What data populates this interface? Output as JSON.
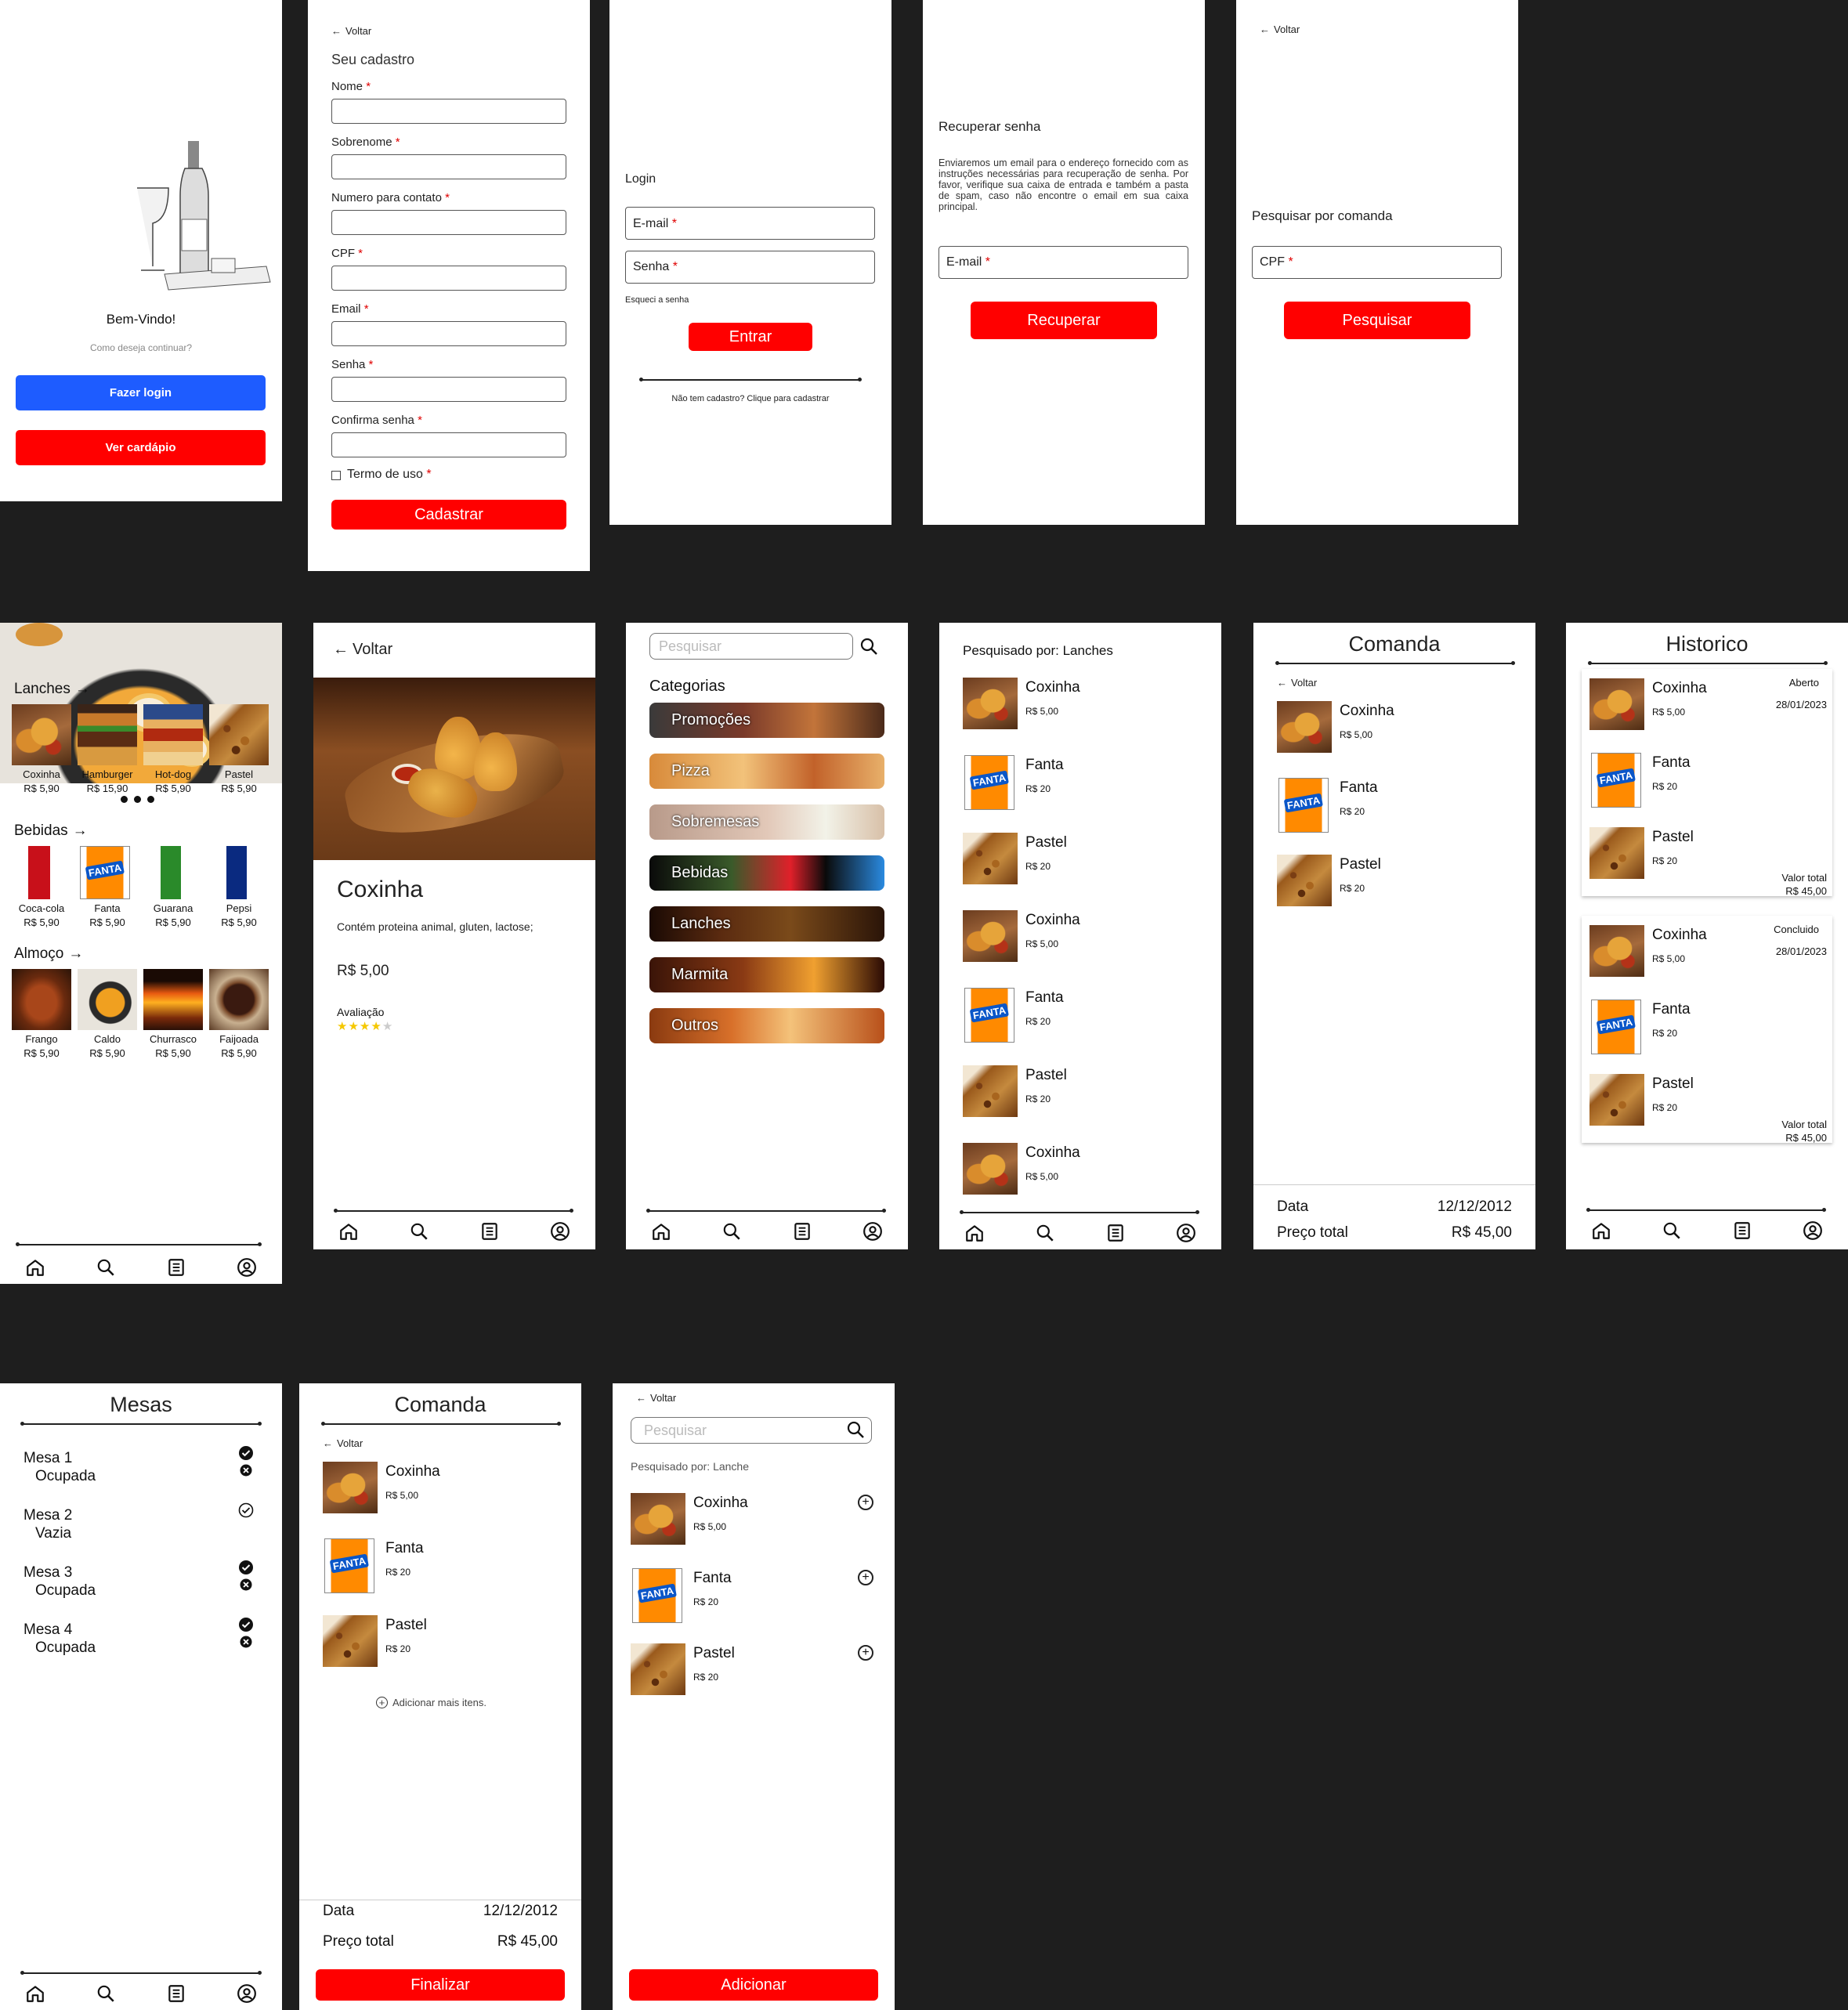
{
  "common": {
    "voltar": "Voltar",
    "required_mark": "*"
  },
  "welcome": {
    "title": "Bem-Vindo!",
    "subtitle": "Como deseja continuar?",
    "login_button": "Fazer login",
    "menu_button": "Ver cardápio"
  },
  "signup": {
    "title": "Seu cadastro",
    "fields": [
      "Nome",
      "Sobrenome",
      "Numero para contato",
      "CPF",
      "Email",
      "Senha",
      "Confirma senha"
    ],
    "terms": "Termo de uso",
    "submit": "Cadastrar"
  },
  "login": {
    "title": "Login",
    "email_label": "E-mail",
    "password_label": "Senha",
    "forgot": "Esqueci a senha",
    "submit": "Entrar",
    "register_link": "Não tem cadastro? Clique para cadastrar"
  },
  "recover": {
    "title": "Recuperar senha",
    "text": "Enviaremos um email para o endereço fornecido com as instruções necessárias para recuperação de senha. Por favor, verifique sua caixa de entrada e também a pasta de spam, caso não encontre o email em sua caixa principal.",
    "email_label": "E-mail",
    "submit": "Recuperar"
  },
  "search_comanda": {
    "title": "Pesquisar por comanda",
    "cpf_label": "CPF",
    "submit": "Pesquisar"
  },
  "menu": {
    "sections": [
      {
        "title": "Lanches",
        "items": [
          {
            "name": "Coxinha",
            "price": "R$ 5,90",
            "img": "coxinha"
          },
          {
            "name": "Hamburger",
            "price": "R$ 15,90",
            "img": "burger"
          },
          {
            "name": "Hot-dog",
            "price": "R$ 5,90",
            "img": "hotdog"
          },
          {
            "name": "Pastel",
            "price": "R$ 5,90",
            "img": "pastel"
          }
        ]
      },
      {
        "title": "Bebidas",
        "items": [
          {
            "name": "Coca-cola",
            "price": "R$ 5,90",
            "img": "coca"
          },
          {
            "name": "Fanta",
            "price": "R$ 5,90",
            "img": "fanta"
          },
          {
            "name": "Guarana",
            "price": "R$ 5,90",
            "img": "guarana"
          },
          {
            "name": "Pepsi",
            "price": "R$ 5,90",
            "img": "pepsi"
          }
        ]
      },
      {
        "title": "Almoço",
        "items": [
          {
            "name": "Frango",
            "price": "R$ 5,90",
            "img": "frango"
          },
          {
            "name": "Caldo",
            "price": "R$ 5,90",
            "img": "caldo"
          },
          {
            "name": "Churrasco",
            "price": "R$ 5,90",
            "img": "churrasco"
          },
          {
            "name": "Faijoada",
            "price": "R$ 5,90",
            "img": "feijoada"
          }
        ]
      }
    ]
  },
  "product": {
    "back": "Voltar",
    "name": "Coxinha",
    "description": "Contém proteina animal, gluten, lactose;",
    "price": "R$ 5,00",
    "rating_label": "Avaliação",
    "rating": 4,
    "rating_max": 5
  },
  "categories": {
    "search_placeholder": "Pesquisar",
    "title": "Categorias",
    "items": [
      "Promoções",
      "Pizza",
      "Sobremesas",
      "Bebidas",
      "Lanches",
      "Marmita",
      "Outros"
    ]
  },
  "results": {
    "title": "Pesquisado por: Lanches",
    "items": [
      {
        "name": "Coxinha",
        "price": "R$ 5,00",
        "img": "coxinha"
      },
      {
        "name": "Fanta",
        "price": "R$ 20",
        "img": "fanta"
      },
      {
        "name": "Pastel",
        "price": "R$ 20",
        "img": "pastel"
      },
      {
        "name": "Coxinha",
        "price": "R$ 5,00",
        "img": "coxinha"
      },
      {
        "name": "Fanta",
        "price": "R$ 20",
        "img": "fanta"
      },
      {
        "name": "Pastel",
        "price": "R$ 20",
        "img": "pastel"
      },
      {
        "name": "Coxinha",
        "price": "R$ 5,00",
        "img": "coxinha"
      }
    ]
  },
  "comanda": {
    "title": "Comanda",
    "items": [
      {
        "name": "Coxinha",
        "price": "R$ 5,00",
        "img": "coxinha"
      },
      {
        "name": "Fanta",
        "price": "R$ 20",
        "img": "fanta"
      },
      {
        "name": "Pastel",
        "price": "R$ 20",
        "img": "pastel"
      }
    ],
    "date_label": "Data",
    "date": "12/12/2012",
    "total_label": "Preço total",
    "total": "R$ 45,00",
    "add_more": "Adicionar mais itens.",
    "finalize": "Finalizar"
  },
  "history": {
    "title": "Historico",
    "orders": [
      {
        "status": "Aberto",
        "date": "28/01/2023",
        "total_label": "Valor total",
        "total": "R$ 45,00"
      },
      {
        "status": "Concluido",
        "date": "28/01/2023",
        "total_label": "Valor total",
        "total": "R$ 45,00"
      }
    ]
  },
  "tables": {
    "title": "Mesas",
    "items": [
      {
        "name": "Mesa 1",
        "status": "Ocupada",
        "filled": true
      },
      {
        "name": "Mesa 2",
        "status": "Vazia",
        "filled": false
      },
      {
        "name": "Mesa 3",
        "status": "Ocupada",
        "filled": true
      },
      {
        "name": "Mesa 4",
        "status": "Ocupada",
        "filled": true
      }
    ]
  },
  "add_items": {
    "search_placeholder": "Pesquisar",
    "title": "Pesquisado por: Lanche",
    "submit": "Adicionar"
  },
  "icons": {
    "nav": [
      "home-icon",
      "search-icon",
      "list-icon",
      "profile-icon"
    ]
  },
  "colors": {
    "primary_red": "#ff0000",
    "primary_blue": "#1e5cff",
    "background": "#1e1e1e",
    "star": "#f5c800"
  }
}
